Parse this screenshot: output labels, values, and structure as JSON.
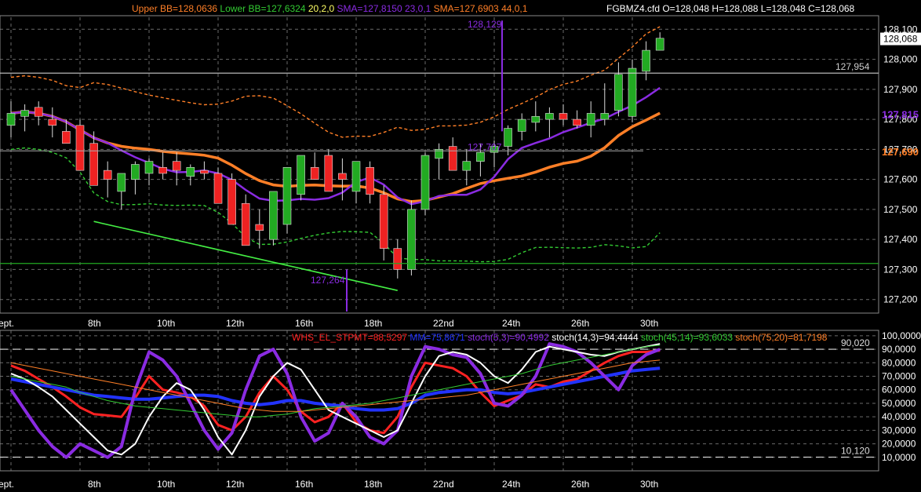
{
  "price_panel": {
    "legend": [
      {
        "text": "Upper BB=128,0636",
        "color": "#ff7f27"
      },
      {
        "text": "Lower BB=127,6324",
        "color": "#33cc33"
      },
      {
        "text": "20,2,0",
        "color": "#ffff66"
      },
      {
        "text": "SMA=127,8150",
        "color": "#8a2be2"
      },
      {
        "text": "23,0,1",
        "color": "#8a2be2"
      },
      {
        "text": "SMA=127,6903",
        "color": "#ff7f27"
      },
      {
        "text": "44,0,1",
        "color": "#ff7f27"
      }
    ],
    "symbol_info": "FGBMZ4.cfd O=128,048 H=128,088 L=128,048 C=128,068",
    "y_ticks": [
      "128,100",
      "128,000",
      "127,900",
      "127,800",
      "127,700",
      "127,600",
      "127,500",
      "127,400",
      "127,300",
      "127,200"
    ],
    "current_price": "128,068",
    "sma23_value": "127,815",
    "sma44_value": "127,690",
    "hline_label": "127,954",
    "annotations": {
      "high": "128,129",
      "low": "127,264",
      "mid": "127,707"
    }
  },
  "osc_panel": {
    "legend": [
      {
        "text": "WHS_EL_STPMT=88,5297",
        "color": "#ff2222"
      },
      {
        "text": "MM=75,8671",
        "color": "#2233ff"
      },
      {
        "text": "stoch(5,3)=90,4992",
        "color": "#8a2be2"
      },
      {
        "text": "stoch(14,3)=94,4444",
        "color": "#ffffff"
      },
      {
        "text": "stoch(45,14)=93,6033",
        "color": "#33cc33"
      },
      {
        "text": "stoch(75,20)=81,7198",
        "color": "#ff7f27"
      }
    ],
    "y_ticks": [
      "100,0000",
      "90,0000",
      "80,0000",
      "70,0000",
      "60,0000",
      "50,0000",
      "40,0000",
      "30,0000",
      "20,0000",
      "10,0000"
    ],
    "upper_level": "90,020",
    "lower_level": "10,120"
  },
  "date_labels": [
    "ept.",
    "8th",
    "10th",
    "12th",
    "16th",
    "18th",
    "22nd",
    "24th",
    "26th",
    "30th"
  ],
  "colors": {
    "bull": "#22aa22",
    "bear": "#ee2222",
    "sma23": "#8a2be2",
    "sma44": "#ff7f27",
    "upper_bb": "#ff7f27",
    "lower_bb": "#33cc33",
    "grid": "#6a6a6a"
  },
  "chart_data": [
    {
      "type": "candlestick",
      "title": "FGBMZ4.cfd",
      "x": [
        "ept.",
        "",
        "",
        "",
        "",
        "8th",
        "",
        "",
        "",
        "",
        "10th",
        "",
        "",
        "",
        "",
        "12th",
        "",
        "",
        "",
        "",
        "16th",
        "",
        "",
        "",
        "",
        "18th",
        "",
        "",
        "",
        "",
        "22nd",
        "",
        "",
        "",
        "",
        "24th",
        "",
        "",
        "",
        "",
        "26th",
        "",
        "",
        "",
        "",
        "30th",
        "",
        ""
      ],
      "open": [
        127.78,
        127.81,
        127.84,
        127.8,
        127.76,
        127.78,
        127.72,
        127.63,
        127.56,
        127.6,
        127.62,
        127.64,
        127.66,
        127.61,
        127.63,
        127.62,
        127.6,
        127.52,
        127.45,
        127.4,
        127.45,
        127.55,
        127.64,
        127.68,
        127.62,
        127.56,
        127.64,
        127.55,
        127.37,
        127.3,
        127.5,
        127.67,
        127.71,
        127.63,
        127.66,
        127.69,
        127.71,
        127.76,
        127.79,
        127.8,
        127.82,
        127.8,
        127.78,
        127.8,
        127.83,
        127.81,
        127.96,
        128.03
      ],
      "high": [
        127.86,
        127.85,
        127.86,
        127.84,
        127.8,
        127.8,
        127.76,
        127.66,
        127.62,
        127.66,
        127.67,
        127.69,
        127.69,
        127.65,
        127.66,
        127.64,
        127.62,
        127.55,
        127.5,
        127.48,
        127.56,
        127.66,
        127.69,
        127.7,
        127.67,
        127.64,
        127.66,
        127.58,
        127.4,
        127.53,
        127.69,
        127.72,
        127.74,
        127.7,
        127.72,
        127.73,
        127.78,
        127.82,
        127.86,
        127.84,
        127.85,
        127.83,
        127.86,
        127.92,
        127.99,
        128.0,
        128.06,
        128.09
      ],
      "low": [
        127.74,
        127.76,
        127.78,
        127.74,
        127.72,
        127.68,
        127.58,
        127.54,
        127.5,
        127.55,
        127.58,
        127.6,
        127.58,
        127.58,
        127.6,
        127.58,
        127.48,
        127.42,
        127.37,
        127.38,
        127.42,
        127.53,
        127.6,
        127.6,
        127.53,
        127.52,
        127.52,
        127.33,
        127.27,
        127.28,
        127.48,
        127.6,
        127.63,
        127.58,
        127.61,
        127.64,
        127.68,
        127.73,
        127.76,
        127.74,
        127.78,
        127.77,
        127.74,
        127.78,
        127.81,
        127.79,
        127.93,
        128.03
      ],
      "close": [
        127.82,
        127.83,
        127.81,
        127.78,
        127.72,
        127.63,
        127.58,
        127.6,
        127.62,
        127.65,
        127.66,
        127.62,
        127.63,
        127.64,
        127.62,
        127.52,
        127.45,
        127.38,
        127.43,
        127.56,
        127.64,
        127.68,
        127.6,
        127.56,
        127.6,
        127.66,
        127.55,
        127.37,
        127.3,
        127.5,
        127.68,
        127.7,
        127.63,
        127.66,
        127.69,
        127.71,
        127.77,
        127.8,
        127.81,
        127.82,
        127.8,
        127.78,
        127.82,
        127.82,
        127.95,
        127.97,
        128.03,
        128.07
      ],
      "ylim": [
        127.16,
        128.14
      ]
    },
    {
      "type": "line",
      "title": "",
      "x": [
        "ept.",
        "",
        "",
        "",
        "",
        "8th",
        "",
        "",
        "",
        "",
        "10th",
        "",
        "",
        "",
        "",
        "12th",
        "",
        "",
        "",
        "",
        "16th",
        "",
        "",
        "",
        "",
        "18th",
        "",
        "",
        "",
        "",
        "22nd",
        "",
        "",
        "",
        "",
        "24th",
        "",
        "",
        "",
        "",
        "26th",
        "",
        "",
        "",
        "",
        "30th",
        "",
        ""
      ],
      "ylim": [
        0,
        104
      ],
      "upper_level": 90.02,
      "lower_level": 10.12,
      "series": [
        {
          "name": "WHS_EL_STPMT",
          "values": [
            78,
            74,
            68,
            62,
            55,
            47,
            42,
            41,
            40,
            54,
            70,
            60,
            58,
            55,
            48,
            34,
            30,
            40,
            58,
            70,
            60,
            44,
            36,
            40,
            50,
            36,
            30,
            28,
            40,
            62,
            80,
            78,
            76,
            70,
            58,
            48,
            52,
            56,
            64,
            62,
            66,
            68,
            74,
            80,
            85,
            88,
            88,
            89
          ]
        },
        {
          "name": "MM",
          "values": [
            68,
            66,
            64,
            62,
            60,
            58,
            56,
            55,
            54,
            53,
            53,
            54,
            55,
            56,
            56,
            55,
            52,
            50,
            49,
            50,
            52,
            52,
            50,
            49,
            48,
            46,
            45,
            45,
            46,
            50,
            56,
            58,
            59,
            60,
            60,
            58,
            57,
            58,
            60,
            62,
            64,
            66,
            68,
            70,
            72,
            74,
            75,
            76
          ]
        },
        {
          "name": "stoch(5,3)",
          "values": [
            60,
            45,
            30,
            18,
            10,
            20,
            15,
            10,
            18,
            60,
            88,
            82,
            70,
            50,
            30,
            16,
            28,
            60,
            85,
            90,
            72,
            40,
            22,
            28,
            50,
            40,
            25,
            20,
            30,
            70,
            92,
            90,
            86,
            84,
            72,
            50,
            48,
            56,
            70,
            94,
            92,
            88,
            80,
            70,
            60,
            78,
            86,
            90
          ]
        },
        {
          "name": "stoch(14,3)",
          "values": [
            72,
            68,
            62,
            55,
            45,
            35,
            25,
            15,
            12,
            20,
            40,
            55,
            65,
            60,
            45,
            25,
            12,
            30,
            55,
            70,
            80,
            75,
            60,
            45,
            40,
            35,
            30,
            25,
            30,
            50,
            70,
            85,
            88,
            86,
            80,
            70,
            65,
            75,
            88,
            92,
            90,
            88,
            86,
            85,
            88,
            90,
            92,
            94
          ]
        },
        {
          "name": "stoch(45,14)",
          "values": [
            70,
            68,
            66,
            64,
            62,
            58,
            55,
            52,
            50,
            48,
            47,
            46,
            45,
            44,
            43,
            42,
            41,
            40,
            40,
            41,
            42,
            44,
            46,
            47,
            48,
            49,
            50,
            52,
            54,
            56,
            58,
            60,
            62,
            64,
            66,
            68,
            70,
            72,
            75,
            78,
            80,
            82,
            84,
            86,
            88,
            90,
            92,
            93
          ]
        },
        {
          "name": "stoch(75,20)",
          "values": [
            80,
            78,
            76,
            74,
            72,
            70,
            68,
            66,
            64,
            62,
            60,
            58,
            56,
            54,
            52,
            50,
            48,
            46,
            45,
            44,
            44,
            44,
            45,
            46,
            47,
            48,
            49,
            50,
            51,
            52,
            53,
            54,
            55,
            56,
            58,
            60,
            62,
            64,
            66,
            68,
            70,
            72,
            74,
            76,
            78,
            80,
            81,
            82
          ]
        }
      ]
    }
  ]
}
